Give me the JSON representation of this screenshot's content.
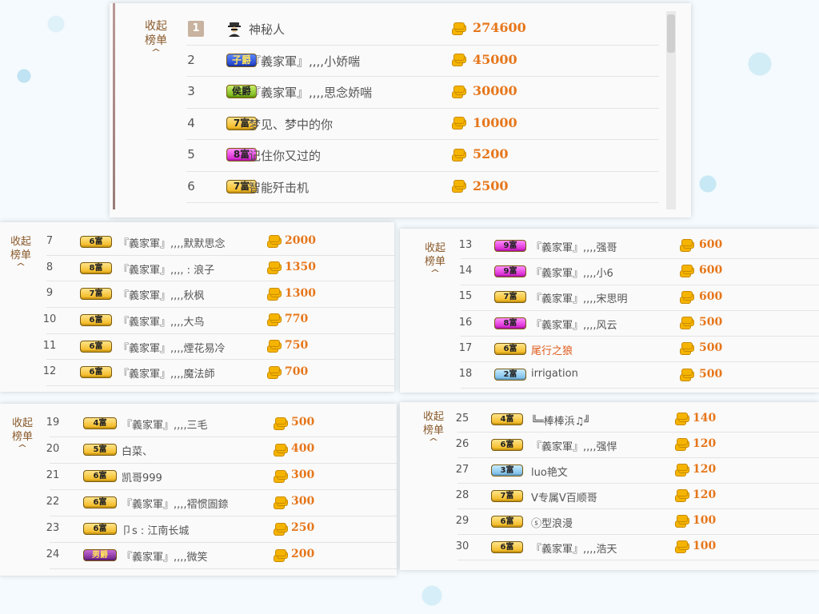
{
  "collapse_label": [
    "收起",
    "榜单"
  ],
  "panels": [
    {
      "rows": [
        {
          "rank": "1",
          "badge": "",
          "badge_style": "",
          "name": "神秘人",
          "score": "274600",
          "special": "mystery"
        },
        {
          "rank": "2",
          "badge": "子爵",
          "badge_style": "blue",
          "name": "『義家軍』,,,,小娇喘",
          "score": "45000"
        },
        {
          "rank": "3",
          "badge": "侯爵",
          "badge_style": "green",
          "name": "『義家軍』,,,,思念娇喘",
          "score": "30000"
        },
        {
          "rank": "4",
          "badge": "7富",
          "badge_style": "gold",
          "name": "梦见、梦中的你",
          "score": "10000"
        },
        {
          "rank": "5",
          "badge": "8富",
          "badge_style": "magenta",
          "name": "记住你又过的",
          "score": "5200"
        },
        {
          "rank": "6",
          "badge": "7富",
          "badge_style": "gold",
          "name": "智能歼击机",
          "score": "2500"
        }
      ]
    },
    {
      "rows": [
        {
          "rank": "7",
          "badge": "6富",
          "badge_style": "gold",
          "name": "『義家軍』,,,,默默思念",
          "score": "2000"
        },
        {
          "rank": "8",
          "badge": "8富",
          "badge_style": "gold",
          "name": "『義家軍』,,,, : 浪子",
          "score": "1350"
        },
        {
          "rank": "9",
          "badge": "7富",
          "badge_style": "gold",
          "name": "『義家軍』,,,,秋枫",
          "score": "1300"
        },
        {
          "rank": "10",
          "badge": "6富",
          "badge_style": "gold",
          "name": "『義家軍』,,,,大鸟",
          "score": "770"
        },
        {
          "rank": "11",
          "badge": "6富",
          "badge_style": "gold",
          "name": "『義家軍』,,,,煙花易冷",
          "score": "750"
        },
        {
          "rank": "12",
          "badge": "6富",
          "badge_style": "gold",
          "name": "『義家軍』,,,,魔法師",
          "score": "700"
        }
      ]
    },
    {
      "rows": [
        {
          "rank": "13",
          "badge": "9富",
          "badge_style": "magenta",
          "name": "『義家軍』,,,,强哥",
          "score": "600"
        },
        {
          "rank": "14",
          "badge": "9富",
          "badge_style": "magenta",
          "name": "『義家軍』,,,,小6",
          "score": "600"
        },
        {
          "rank": "15",
          "badge": "7富",
          "badge_style": "gold",
          "name": "『義家軍』,,,,宋思明",
          "score": "600"
        },
        {
          "rank": "16",
          "badge": "8富",
          "badge_style": "magenta",
          "name": "『義家軍』,,,,风云",
          "score": "500"
        },
        {
          "rank": "17",
          "badge": "6富",
          "badge_style": "gold",
          "name": "尾行之狼",
          "score": "500",
          "orange": true
        },
        {
          "rank": "18",
          "badge": "2富",
          "badge_style": "lightblue",
          "name": "irrigation",
          "score": "500"
        }
      ]
    },
    {
      "rows": [
        {
          "rank": "19",
          "badge": "4富",
          "badge_style": "gold",
          "name": "『義家軍』,,,,三毛",
          "score": "500"
        },
        {
          "rank": "20",
          "badge": "5富",
          "badge_style": "gold",
          "name": "白菜、",
          "score": "400"
        },
        {
          "rank": "21",
          "badge": "6富",
          "badge_style": "gold",
          "name": "凯哥999",
          "score": "300"
        },
        {
          "rank": "22",
          "badge": "6富",
          "badge_style": "gold",
          "name": "『義家軍』,,,,褶惯圄錼",
          "score": "300"
        },
        {
          "rank": "23",
          "badge": "6富",
          "badge_style": "gold",
          "name": "卩s : 江南长城",
          "score": "250"
        },
        {
          "rank": "24",
          "badge": "男爵",
          "badge_style": "purple",
          "name": "『義家軍』,,,,微笑",
          "score": "200"
        }
      ]
    },
    {
      "rows": [
        {
          "rank": "25",
          "badge": "4富",
          "badge_style": "gold",
          "name": "╚═棒棒浜♫╝",
          "score": "140"
        },
        {
          "rank": "26",
          "badge": "6富",
          "badge_style": "gold",
          "name": "『義家軍』,,,,强悍",
          "score": "120"
        },
        {
          "rank": "27",
          "badge": "3富",
          "badge_style": "lightblue",
          "name": "luo艳文",
          "score": "120"
        },
        {
          "rank": "28",
          "badge": "7富",
          "badge_style": "gold",
          "name": "V专属V百顺哥",
          "score": "120"
        },
        {
          "rank": "29",
          "badge": "6富",
          "badge_style": "gold",
          "name": "ⓢ型浪漫",
          "score": "100"
        },
        {
          "rank": "30",
          "badge": "6富",
          "badge_style": "gold",
          "name": "『義家軍』,,,,浩天",
          "score": "100"
        }
      ]
    }
  ],
  "colors": {
    "score": "#e6761a",
    "accent": "#8a5a2b",
    "name_highlight": "#e05a1a"
  },
  "icons": {
    "coin": "gold-coin-stack-icon",
    "mystery": "mystery-person-icon",
    "collapse": "caret-up-icon"
  }
}
